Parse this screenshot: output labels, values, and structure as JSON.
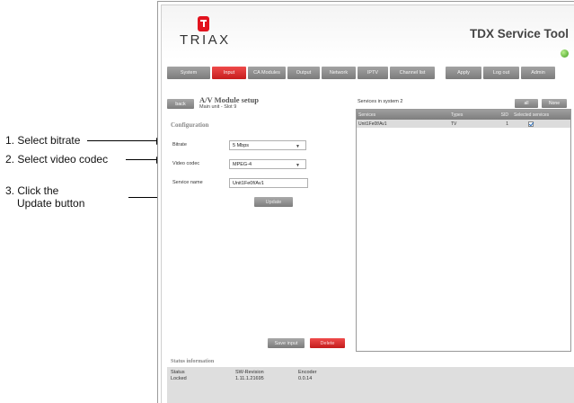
{
  "callouts": [
    "1. Select bitrate",
    "2. Select video codec",
    "3. Click the",
    "Update button"
  ],
  "header": {
    "brand": "TRIAX",
    "tool_title": "TDX Service Tool",
    "status_color": "#3e9c1d"
  },
  "nav": {
    "items": [
      "System",
      "Input",
      "CA Modules",
      "Output",
      "Network",
      "IPTV",
      "Channel list"
    ],
    "active": "Input",
    "actions": [
      "Apply",
      "Log out",
      "Admin"
    ]
  },
  "module": {
    "back_label": "back",
    "title": "A/V Module setup",
    "subtitle": "Main unit - Slot 9"
  },
  "configuration": {
    "title": "Configuration",
    "bitrate_label": "Bitrate",
    "bitrate_value": "5 Mbps",
    "codec_label": "Video codec",
    "codec_value": "MPEG-4",
    "service_name_label": "Service name",
    "service_name_value": "Unit1Fe0f/Av1",
    "update_label": "Update"
  },
  "services": {
    "title": "Services in system 2",
    "buttons": [
      "all",
      "None"
    ],
    "columns": [
      "Services",
      "Types",
      "SID",
      "Selected services"
    ],
    "rows": [
      {
        "service": "Unit1Fe0f/Av1",
        "type": "TV",
        "sid": "1",
        "selected": true
      }
    ]
  },
  "bottom_buttons": {
    "save_label": "Save input",
    "delete_label": "Delete"
  },
  "status": {
    "title": "Status information",
    "columns": [
      {
        "header": "Status",
        "value": "Locked"
      },
      {
        "header": "SW-Revision",
        "value": "1.11.1.21695"
      },
      {
        "header": "Encoder",
        "value": "0.0.14"
      }
    ]
  }
}
